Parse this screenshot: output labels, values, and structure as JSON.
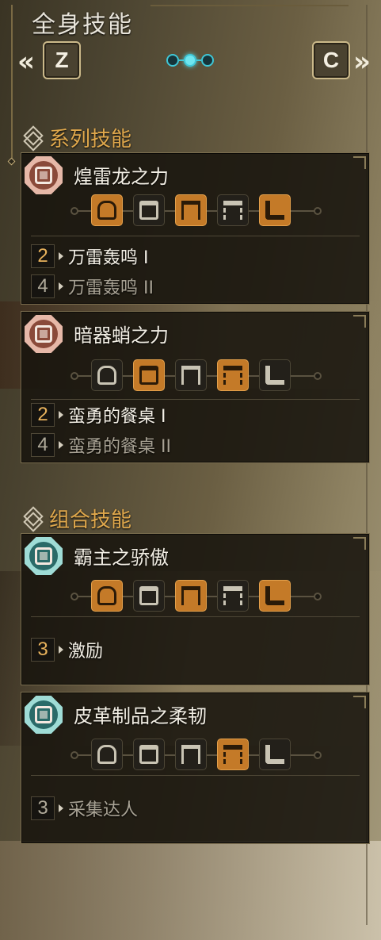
{
  "header": {
    "title": "全身技能",
    "prev_arrow": "«",
    "next_arrow": "»",
    "prev_key": "Z",
    "next_key": "C",
    "pages_total": 3,
    "page_active": 2
  },
  "colors": {
    "accent_orange": "#e0a84c",
    "active_piece": "#c47a28",
    "page_dot": "#3fc6d6"
  },
  "sections": {
    "series": {
      "label": "系列技能",
      "icon": "layers-icon"
    },
    "combo": {
      "label": "组合技能",
      "icon": "layers-icon"
    }
  },
  "cards": [
    {
      "name": "煌雷龙之力",
      "emblem": "series-armor-emblem",
      "pieces": [
        {
          "part": "head",
          "equipped": true
        },
        {
          "part": "chest",
          "equipped": false
        },
        {
          "part": "arms",
          "equipped": true
        },
        {
          "part": "waist",
          "equipped": false
        },
        {
          "part": "legs",
          "equipped": true
        }
      ],
      "skills": [
        {
          "count": "2",
          "name": "万雷轰鸣 I",
          "active": true
        },
        {
          "count": "4",
          "name": "万雷轰鸣 II",
          "active": false
        }
      ]
    },
    {
      "name": "暗器蛸之力",
      "emblem": "series-armor-emblem",
      "pieces": [
        {
          "part": "head",
          "equipped": false
        },
        {
          "part": "chest",
          "equipped": true
        },
        {
          "part": "arms",
          "equipped": false
        },
        {
          "part": "waist",
          "equipped": true
        },
        {
          "part": "legs",
          "equipped": false
        }
      ],
      "skills": [
        {
          "count": "2",
          "name": "蛮勇的餐桌 I",
          "active": true
        },
        {
          "count": "4",
          "name": "蛮勇的餐桌 II",
          "active": false
        }
      ]
    },
    {
      "name": "霸主之骄傲",
      "emblem": "combo-armor-emblem",
      "pieces": [
        {
          "part": "head",
          "equipped": true
        },
        {
          "part": "chest",
          "equipped": false
        },
        {
          "part": "arms",
          "equipped": true
        },
        {
          "part": "waist",
          "equipped": false
        },
        {
          "part": "legs",
          "equipped": true
        }
      ],
      "skills": [
        {
          "count": "3",
          "name": "激励",
          "active": true
        }
      ]
    },
    {
      "name": "皮革制品之柔韧",
      "emblem": "combo-armor-emblem",
      "pieces": [
        {
          "part": "head",
          "equipped": false
        },
        {
          "part": "chest",
          "equipped": false
        },
        {
          "part": "arms",
          "equipped": false
        },
        {
          "part": "waist",
          "equipped": true
        },
        {
          "part": "legs",
          "equipped": false
        }
      ],
      "skills": [
        {
          "count": "3",
          "name": "采集达人",
          "active": false
        }
      ]
    }
  ]
}
